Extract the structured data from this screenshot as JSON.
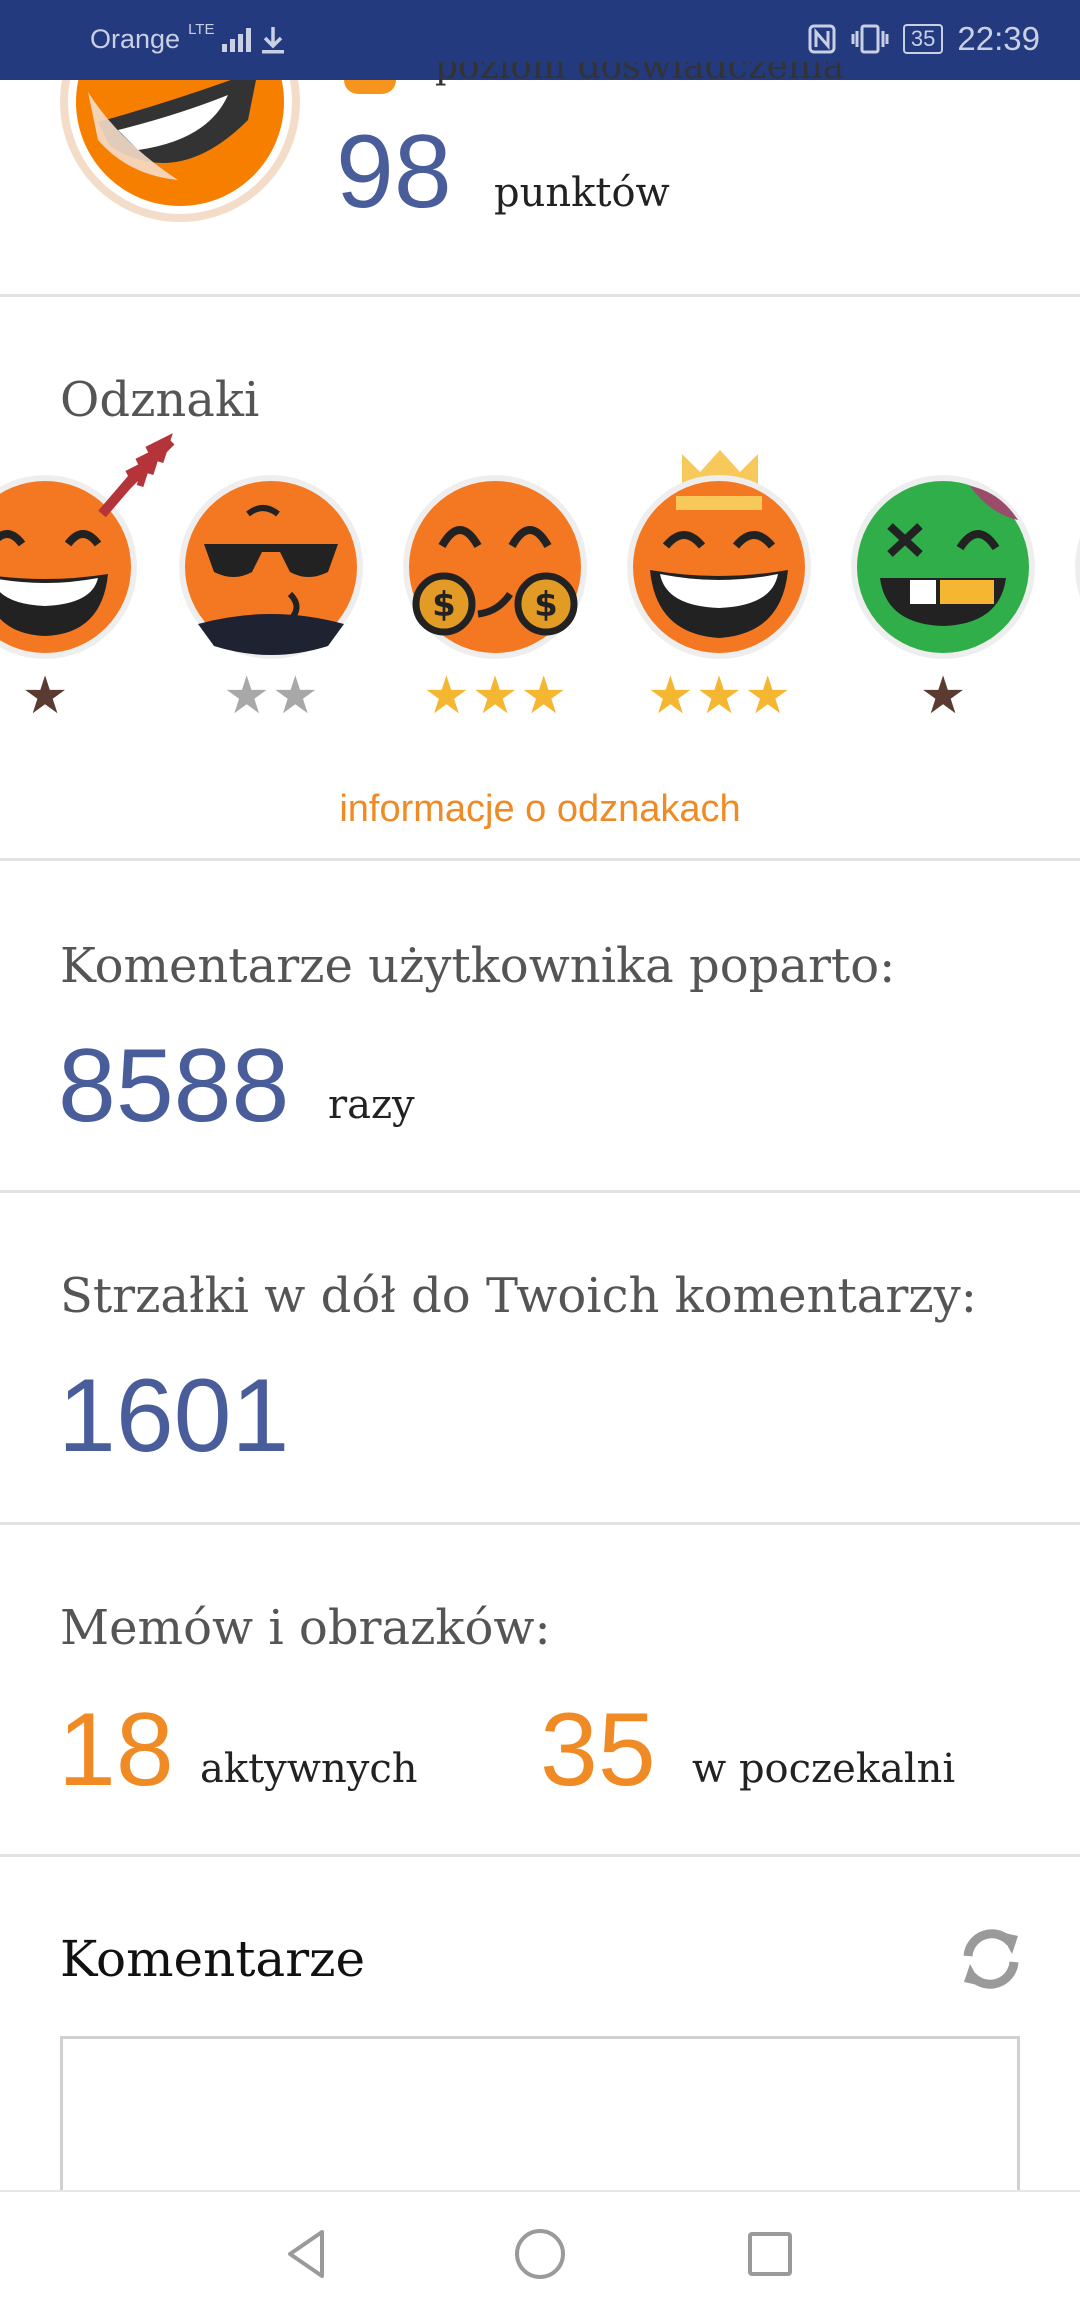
{
  "status_bar": {
    "carrier": "Orange",
    "network": "LTE",
    "time": "22:39",
    "battery": "35",
    "icons": [
      "signal-icon",
      "download-icon",
      "nfc-icon",
      "vibrate-icon",
      "battery-icon"
    ]
  },
  "profile": {
    "level_label": "poziom doświadczenia",
    "points_value": "98",
    "points_label": "punktów"
  },
  "badges": {
    "title": "Odznaki",
    "items": [
      {
        "name": "laughing-badge",
        "stars": 1,
        "star_color": "#5b3a32"
      },
      {
        "name": "sunglasses-badge",
        "stars": 2,
        "star_color": "#a8a8a8"
      },
      {
        "name": "money-badge",
        "stars": 3,
        "star_color": "#f5b731"
      },
      {
        "name": "crown-badge",
        "stars": 3,
        "star_color": "#f5b731"
      },
      {
        "name": "zombie-badge",
        "stars": 1,
        "star_color": "#5b3a32"
      }
    ],
    "info_link": "informacje o odznakach"
  },
  "stats": {
    "upvotes_label": "Komentarze użytkownika poparto:",
    "upvotes_value": "8588",
    "upvotes_unit": "razy",
    "downvotes_label": "Strzałki w dół do Twoich komentarzy:",
    "downvotes_value": "1601",
    "memes_label": "Memów i obrazków:",
    "memes_active_value": "18",
    "memes_active_label": "aktywnych",
    "memes_waiting_value": "35",
    "memes_waiting_label": "w poczekalni"
  },
  "comments": {
    "title": "Komentarze",
    "input_value": ""
  },
  "colors": {
    "status_bar": "#243a7f",
    "accent_orange": "#f08a24",
    "number_blue": "#485d99"
  },
  "nav": {
    "buttons": [
      "back-icon",
      "home-icon",
      "recents-icon"
    ]
  }
}
